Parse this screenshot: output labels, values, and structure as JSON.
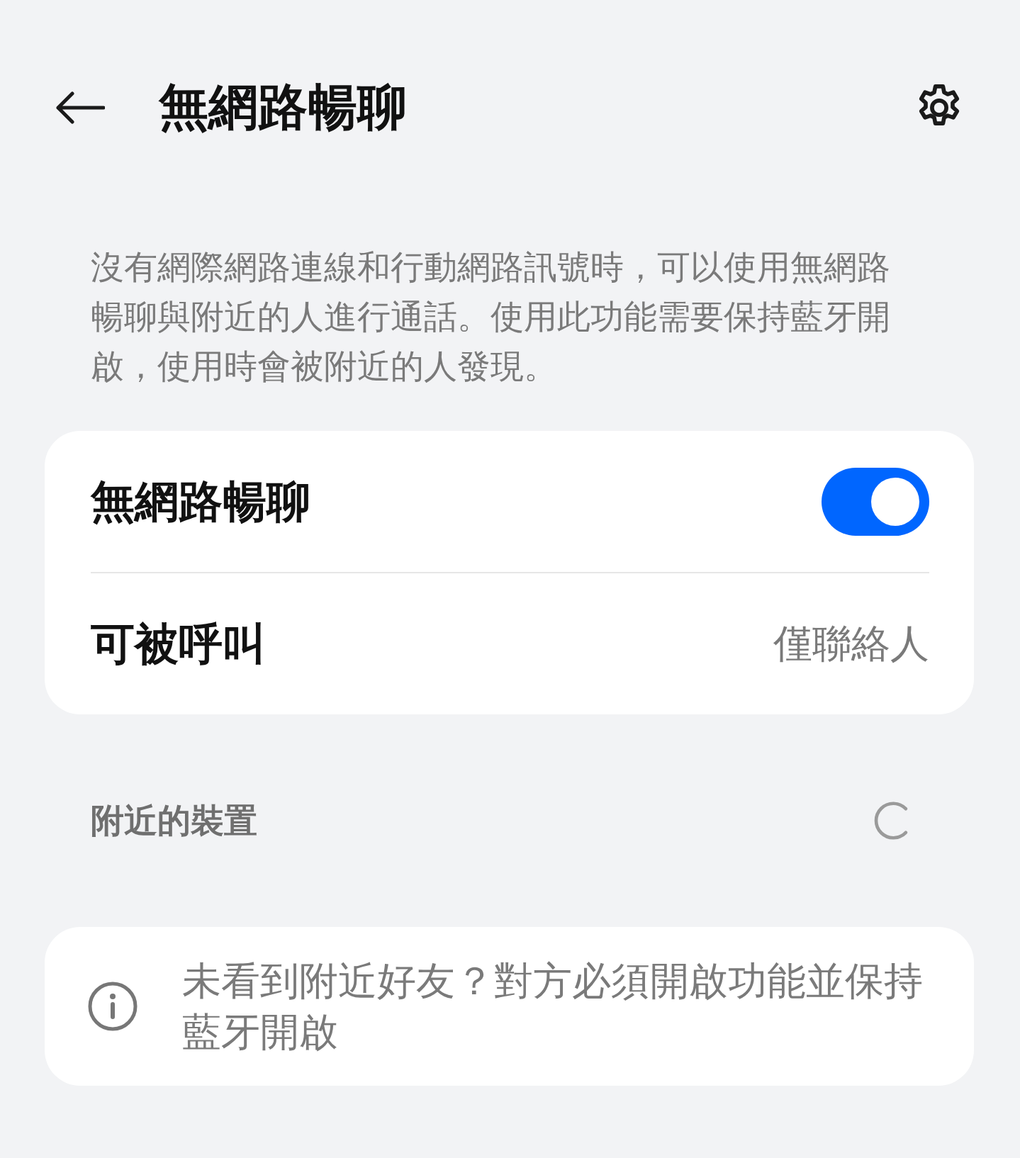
{
  "header": {
    "title": "無網路暢聊"
  },
  "description": "沒有網際網路連線和行動網路訊號時，可以使用無網路暢聊與附近的人進行通話。使用此功能需要保持藍牙開啟，使用時會被附近的人發現。",
  "settings": [
    {
      "kind": "toggle",
      "label": "無網路暢聊",
      "on": true
    },
    {
      "kind": "value",
      "label": "可被呼叫",
      "value": "僅聯絡人"
    }
  ],
  "nearby_section": {
    "label": "附近的裝置",
    "loading": true
  },
  "notice": {
    "text": "未看到附近好友？對方必須開啟功能並保持藍牙開啟"
  }
}
